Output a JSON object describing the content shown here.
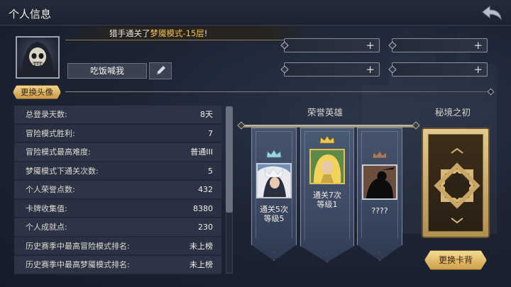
{
  "header": {
    "title": "个人信息"
  },
  "announcement": {
    "prefix": "猎手通关了",
    "highlight": "梦魇模式-15层",
    "suffix": "!"
  },
  "profile": {
    "nickname": "吃饭喊我",
    "change_avatar_label": "更换头像"
  },
  "stats": [
    {
      "label": "总登录天数:",
      "value": "8天"
    },
    {
      "label": "冒险模式胜利:",
      "value": "7"
    },
    {
      "label": "冒险模式最高难度:",
      "value": "普通III"
    },
    {
      "label": "梦魇模式下通关次数:",
      "value": "5"
    },
    {
      "label": "个人荣誉点数:",
      "value": "432"
    },
    {
      "label": "卡牌收集值:",
      "value": "8380"
    },
    {
      "label": "个人成就点:",
      "value": "230"
    },
    {
      "label": "历史赛季中最高冒险模式排名:",
      "value": "未上榜"
    },
    {
      "label": "历史赛季中最高梦魇模式排名:",
      "value": "未上榜"
    }
  ],
  "honor_heroes": {
    "title": "荣誉英雄",
    "heroes": [
      {
        "line1": "通关5次",
        "line2": "等级5",
        "crown": "silver"
      },
      {
        "line1": "通关7次",
        "line2": "等级1",
        "crown": "gold"
      },
      {
        "line1": "????",
        "line2": "",
        "crown": "bronze"
      }
    ]
  },
  "secret_realm": {
    "title": "秘境之初",
    "change_back_label": "更换卡背"
  },
  "colors": {
    "gold": "#e2be55",
    "highlight": "#f5c24a",
    "panel": "#2d3446"
  }
}
